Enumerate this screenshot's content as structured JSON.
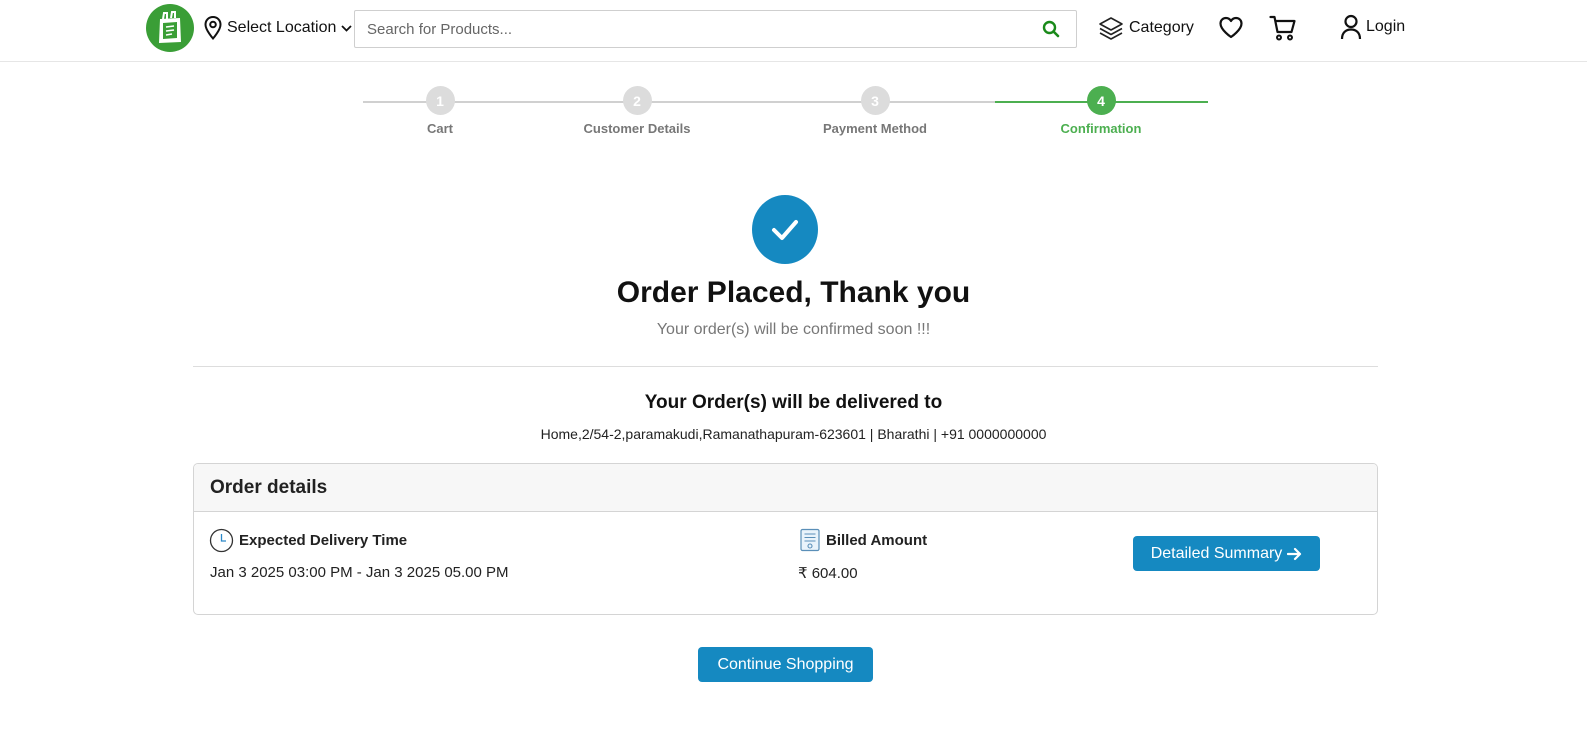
{
  "header": {
    "location_label": "Select Location",
    "search_placeholder": "Search for Products...",
    "category_label": "Category",
    "login_label": "Login"
  },
  "stepper": {
    "steps": [
      {
        "number": "1",
        "label": "Cart",
        "active": false
      },
      {
        "number": "2",
        "label": "Customer Details",
        "active": false
      },
      {
        "number": "3",
        "label": "Payment Method",
        "active": false
      },
      {
        "number": "4",
        "label": "Confirmation",
        "active": true
      }
    ]
  },
  "confirmation": {
    "title": "Order Placed, Thank you",
    "subtitle": "Your order(s) will be confirmed soon !!!",
    "delivery_title": "Your Order(s) will be delivered to",
    "delivery_address": "Home,2/54-2,paramakudi,Ramanathapuram-623601 | Bharathi | +91 0000000000"
  },
  "order_details": {
    "header": "Order details",
    "delivery_time_label": "Expected Delivery Time",
    "delivery_time_value": "Jan 3 2025 03:00 PM - Jan 3 2025 05.00 PM",
    "billed_label": "Billed Amount",
    "billed_value": "₹ 604.00",
    "summary_button": "Detailed Summary"
  },
  "continue_button": "Continue Shopping",
  "colors": {
    "brand_green": "#3a9e36",
    "accent_blue": "#1589c1",
    "step_active": "#4caf50",
    "step_inactive": "#dcdcdc"
  }
}
